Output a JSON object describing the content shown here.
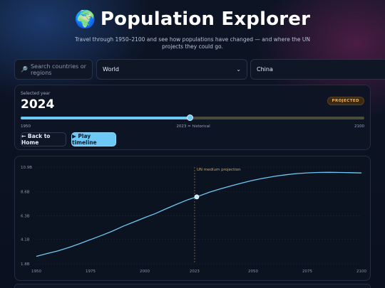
{
  "header": {
    "globe_icon": "🌍",
    "title": "Population Explorer",
    "subtitle": "Travel through 1950–2100 and see how populations have changed — and where the UN projects they could go."
  },
  "controls": {
    "search_placeholder": "Search countries or regions",
    "select_primary": "World",
    "select_secondary": "China"
  },
  "timeline": {
    "selected_label": "Selected year",
    "selected_year": "2024",
    "badge": "PROJECTED",
    "min_label": "1950",
    "mid_label": "2023 = historical",
    "max_label": "2100",
    "min": 1950,
    "max": 2100,
    "value": 2024,
    "back_button": "← Back to Home",
    "play_button": "▶ Play timeline"
  },
  "colors": {
    "accent": "#6ec8f5",
    "badge_text": "#f2b25a",
    "projection_line": "#c9a86a"
  },
  "chart_data": {
    "type": "line",
    "x": [
      1950,
      1955,
      1960,
      1965,
      1970,
      1975,
      1980,
      1985,
      1990,
      1995,
      2000,
      2005,
      2010,
      2015,
      2020,
      2024,
      2030,
      2035,
      2040,
      2045,
      2050,
      2055,
      2060,
      2065,
      2070,
      2075,
      2080,
      2085,
      2090,
      2095,
      2100
    ],
    "values": [
      2.5,
      2.77,
      3.02,
      3.34,
      3.7,
      4.08,
      4.46,
      4.87,
      5.33,
      5.74,
      6.15,
      6.54,
      6.99,
      7.43,
      7.84,
      8.1,
      8.55,
      8.86,
      9.15,
      9.41,
      9.66,
      9.86,
      10.04,
      10.18,
      10.29,
      10.36,
      10.4,
      10.41,
      10.4,
      10.38,
      10.35
    ],
    "yticks": [
      "10.9B",
      "8.6B",
      "6.3B",
      "4.1B",
      "1.8B"
    ],
    "ytick_values": [
      10.9,
      8.6,
      6.3,
      4.1,
      1.8
    ],
    "xticks": [
      "1950",
      "1975",
      "2000",
      "2023",
      "2050",
      "2075",
      "2100"
    ],
    "xtick_values": [
      1950,
      1975,
      2000,
      2023,
      2050,
      2075,
      2100
    ],
    "ylim": [
      1.8,
      10.9
    ],
    "xlim": [
      1950,
      2100
    ],
    "highlight_x": 2024,
    "highlight_value": 8.1,
    "divider_x": 2023,
    "annotation": "UN medium projection",
    "grid": true
  }
}
